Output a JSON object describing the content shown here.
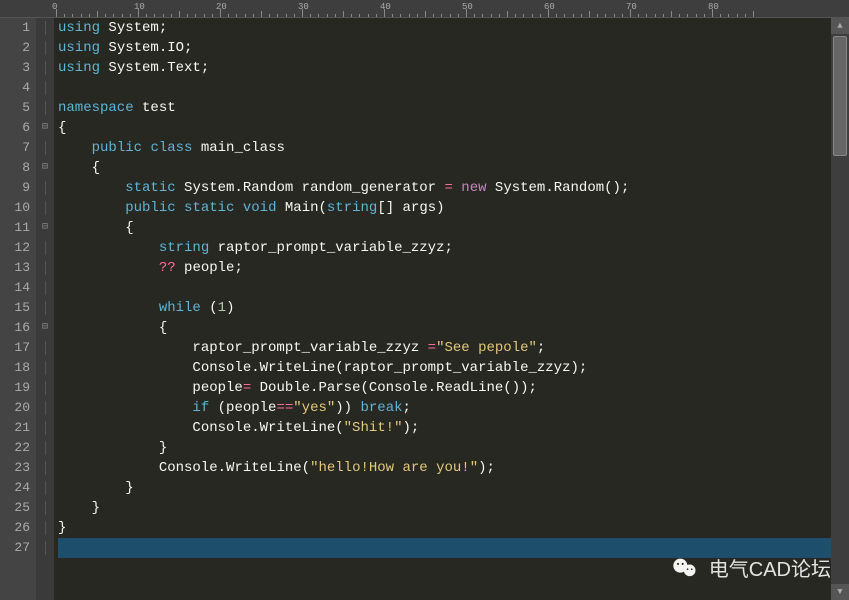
{
  "ruler": {
    "marks": [
      0,
      10,
      20,
      30,
      40,
      50,
      60,
      70,
      80
    ],
    "char_width": 8.2,
    "offset": 56
  },
  "gutter": {
    "lines": [
      "1",
      "2",
      "3",
      "4",
      "5",
      "6",
      "7",
      "8",
      "9",
      "10",
      "11",
      "12",
      "13",
      "14",
      "15",
      "16",
      "17",
      "18",
      "19",
      "20",
      "21",
      "22",
      "23",
      "24",
      "25",
      "26",
      "27"
    ]
  },
  "fold": {
    "marks": {
      "6": "⊟",
      "8": "⊟",
      "11": "⊟",
      "16": "⊟"
    }
  },
  "code": {
    "lines": [
      {
        "indent": 0,
        "tokens": [
          [
            "kw",
            "using"
          ],
          [
            "txt",
            " System;"
          ]
        ]
      },
      {
        "indent": 0,
        "tokens": [
          [
            "kw",
            "using"
          ],
          [
            "txt",
            " System.IO;"
          ]
        ]
      },
      {
        "indent": 0,
        "tokens": [
          [
            "kw",
            "using"
          ],
          [
            "txt",
            " System.Text;"
          ]
        ]
      },
      {
        "indent": 0,
        "tokens": []
      },
      {
        "indent": 0,
        "tokens": [
          [
            "kw",
            "namespace"
          ],
          [
            "txt",
            " test"
          ]
        ]
      },
      {
        "indent": 0,
        "tokens": [
          [
            "txt",
            "{"
          ]
        ]
      },
      {
        "indent": 1,
        "tokens": [
          [
            "kw",
            "public"
          ],
          [
            "txt",
            " "
          ],
          [
            "kw",
            "class"
          ],
          [
            "txt",
            " main_class"
          ]
        ]
      },
      {
        "indent": 1,
        "tokens": [
          [
            "txt",
            "{"
          ]
        ]
      },
      {
        "indent": 2,
        "tokens": [
          [
            "kw",
            "static"
          ],
          [
            "txt",
            " System.Random random_generator "
          ],
          [
            "op",
            "="
          ],
          [
            "txt",
            " "
          ],
          [
            "new",
            "new"
          ],
          [
            "txt",
            " System.Random();"
          ]
        ]
      },
      {
        "indent": 2,
        "tokens": [
          [
            "kw",
            "public"
          ],
          [
            "txt",
            " "
          ],
          [
            "kw",
            "static"
          ],
          [
            "txt",
            " "
          ],
          [
            "kw",
            "void"
          ],
          [
            "txt",
            " Main("
          ],
          [
            "kw",
            "string"
          ],
          [
            "txt",
            "[] args)"
          ]
        ]
      },
      {
        "indent": 2,
        "tokens": [
          [
            "txt",
            "{"
          ]
        ]
      },
      {
        "indent": 3,
        "tokens": [
          [
            "kw",
            "string"
          ],
          [
            "txt",
            " raptor_prompt_variable_zzyz;"
          ]
        ]
      },
      {
        "indent": 3,
        "tokens": [
          [
            "op",
            "??"
          ],
          [
            "txt",
            " people;"
          ]
        ]
      },
      {
        "indent": 0,
        "tokens": []
      },
      {
        "indent": 3,
        "tokens": [
          [
            "kw",
            "while"
          ],
          [
            "txt",
            " ("
          ],
          [
            "num",
            "1"
          ],
          [
            "txt",
            ")"
          ]
        ]
      },
      {
        "indent": 3,
        "tokens": [
          [
            "txt",
            "{"
          ]
        ]
      },
      {
        "indent": 4,
        "tokens": [
          [
            "txt",
            "raptor_prompt_variable_zzyz "
          ],
          [
            "op",
            "="
          ],
          [
            "str",
            "\"See pepole\""
          ],
          [
            "txt",
            ";"
          ]
        ]
      },
      {
        "indent": 4,
        "tokens": [
          [
            "txt",
            "Console.WriteLine(raptor_prompt_variable_zzyz);"
          ]
        ]
      },
      {
        "indent": 4,
        "tokens": [
          [
            "txt",
            "people"
          ],
          [
            "op",
            "="
          ],
          [
            "txt",
            " Double.Parse(Console.ReadLine());"
          ]
        ]
      },
      {
        "indent": 4,
        "tokens": [
          [
            "kw",
            "if"
          ],
          [
            "txt",
            " (people"
          ],
          [
            "op",
            "=="
          ],
          [
            "str",
            "\"yes\""
          ],
          [
            "txt",
            ")) "
          ],
          [
            "kw",
            "break"
          ],
          [
            "txt",
            ";"
          ]
        ]
      },
      {
        "indent": 4,
        "tokens": [
          [
            "txt",
            "Console.WriteLine("
          ],
          [
            "str",
            "\"Shit!\""
          ],
          [
            "txt",
            ");"
          ]
        ]
      },
      {
        "indent": 3,
        "tokens": [
          [
            "txt",
            "}"
          ]
        ]
      },
      {
        "indent": 3,
        "tokens": [
          [
            "txt",
            "Console.WriteLine("
          ],
          [
            "str",
            "\"hello!How are you!\""
          ],
          [
            "txt",
            ");"
          ]
        ]
      },
      {
        "indent": 2,
        "tokens": [
          [
            "txt",
            "}"
          ]
        ]
      },
      {
        "indent": 1,
        "tokens": [
          [
            "txt",
            "}"
          ]
        ]
      },
      {
        "indent": 0,
        "tokens": [
          [
            "txt",
            "}"
          ]
        ]
      },
      {
        "indent": 0,
        "cursor": true,
        "tokens": []
      }
    ]
  },
  "watermark": {
    "text": "电气CAD论坛"
  }
}
